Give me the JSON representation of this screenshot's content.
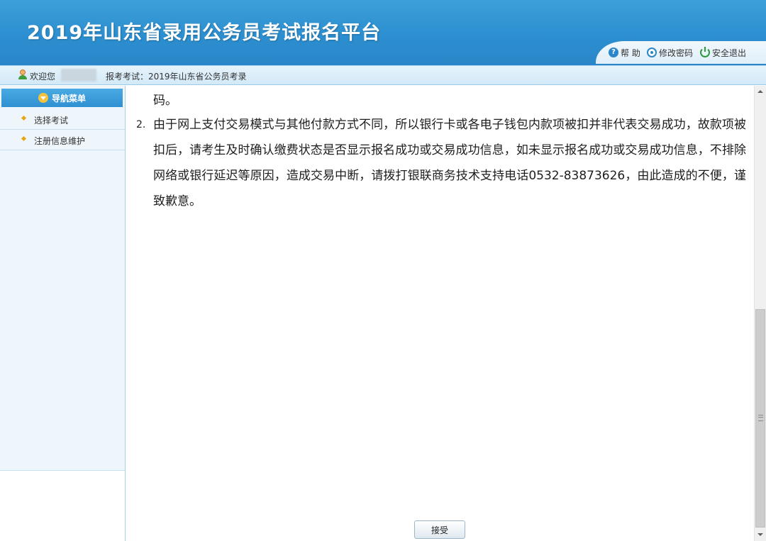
{
  "header": {
    "title": "2019年山东省录用公务员考试报名平台",
    "tools": {
      "help": "帮 助",
      "change_password": "修改密码",
      "logout": "安全退出"
    }
  },
  "welcome_bar": {
    "greeting": "欢迎您",
    "exam_label": "报考考试：2019年山东省公务员考录"
  },
  "sidebar": {
    "nav_header": "导航菜单",
    "items": [
      {
        "label": "选择考试"
      },
      {
        "label": "注册信息维护"
      }
    ]
  },
  "content": {
    "continuation": "码。",
    "item2_number": "2.",
    "item2_text": "由于网上支付交易模式与其他付款方式不同，所以银行卡或各电子钱包内款项被扣并非代表交易成功，故款项被扣后，请考生及时确认缴费状态是否显示报名成功或交易成功信息，如未显示报名成功或交易成功信息，不排除网络或银行延迟等原因，造成交易中断，请拨打银联商务技术支持电话0532-83873626，由此造成的不便，谨致歉意。",
    "accept_button": "接受"
  },
  "colors": {
    "header_blue": "#2c8fd0",
    "nav_header_blue": "#3a9bd9",
    "sidebar_bg": "#eef6fc"
  }
}
